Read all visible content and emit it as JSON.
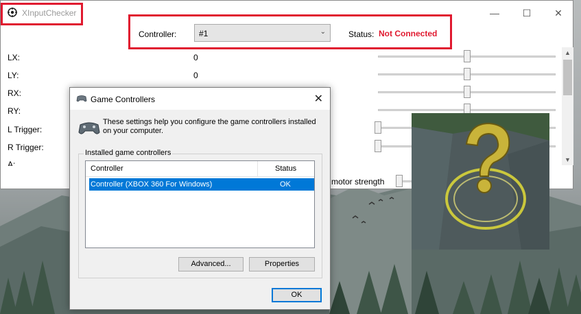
{
  "app": {
    "title": "XInputChecker"
  },
  "window_controls": {
    "minimize": "—",
    "maximize": "☐",
    "close": "✕"
  },
  "controller": {
    "label": "Controller:",
    "selected": "#1",
    "status_label": "Status:",
    "status_value": "Not Connected",
    "status_color": "#e0192f"
  },
  "axes": [
    {
      "label": "LX:",
      "value": "0",
      "level": 0.5
    },
    {
      "label": "LY:",
      "value": "0",
      "level": 0.5
    },
    {
      "label": "RX:",
      "value": "",
      "level": 0.5
    },
    {
      "label": "RY:",
      "value": "",
      "level": 0.5
    },
    {
      "label": "L Trigger:",
      "value": "",
      "level": 0.0
    },
    {
      "label": "R Trigger:",
      "value": "",
      "level": 0.0
    },
    {
      "label": "A:",
      "value": ""
    }
  ],
  "motor": {
    "label": "motor strength",
    "level": 0.0
  },
  "dialog": {
    "title": "Game Controllers",
    "close": "✕",
    "description": "These settings help you configure the game controllers installed on your computer.",
    "group_title": "Installed game controllers",
    "columns": {
      "controller": "Controller",
      "status": "Status"
    },
    "rows": [
      {
        "controller": "Controller (XBOX 360 For Windows)",
        "status": "OK"
      }
    ],
    "buttons": {
      "advanced": "Advanced...",
      "properties": "Properties",
      "ok": "OK"
    }
  },
  "icons": {
    "app": "crosshair-icon",
    "dialog": "gamepad-icon",
    "overlay": "question-mark-icon"
  }
}
